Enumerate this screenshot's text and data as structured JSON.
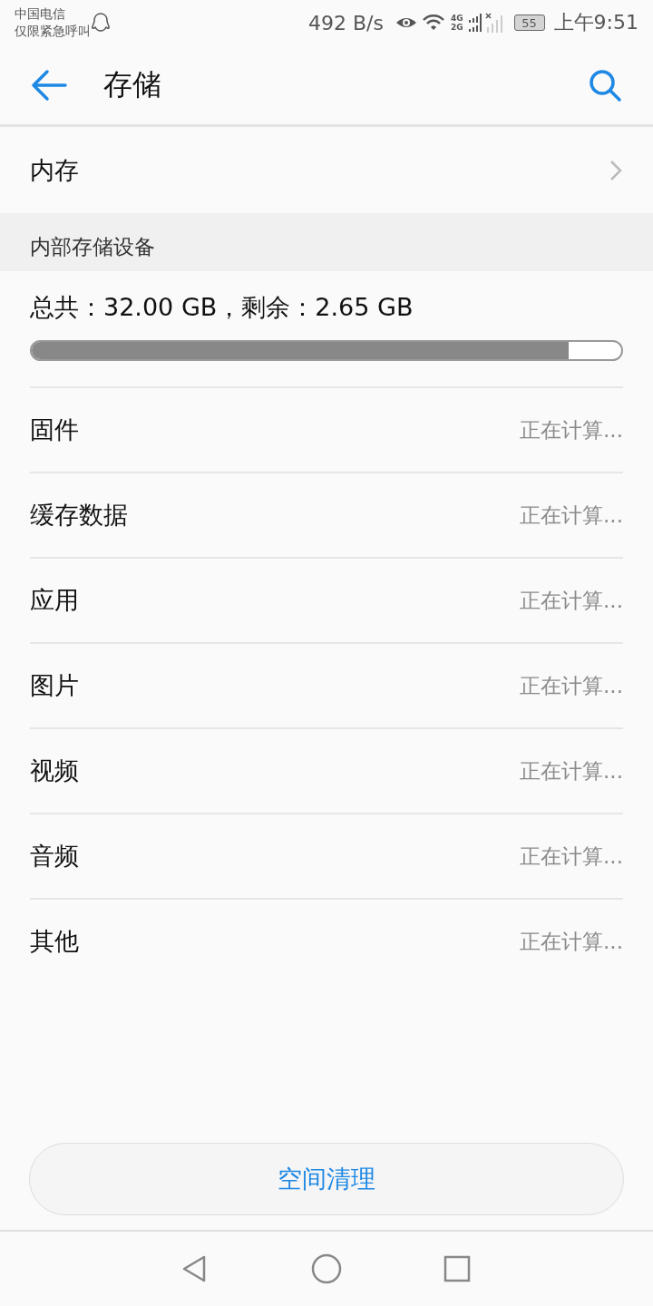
{
  "status_bar": {
    "carrier": "中国电信",
    "carrier_note": "仅限紧急呼叫",
    "speed": "492 B/s",
    "network_1": "4G",
    "network_2": "2G",
    "battery": "55",
    "time": "上午9:51"
  },
  "app_bar": {
    "title": "存储"
  },
  "memory_row": {
    "label": "内存"
  },
  "section": {
    "title": "内部存储设备"
  },
  "summary": {
    "text": "总共：32.00 GB，剩余：2.65 GB",
    "level": 0.91
  },
  "items": [
    {
      "label": "固件",
      "value": "正在计算..."
    },
    {
      "label": "缓存数据",
      "value": "正在计算..."
    },
    {
      "label": "应用",
      "value": "正在计算..."
    },
    {
      "label": "图片",
      "value": "正在计算..."
    },
    {
      "label": "视频",
      "value": "正在计算..."
    },
    {
      "label": "音频",
      "value": "正在计算..."
    },
    {
      "label": "其他",
      "value": "正在计算..."
    }
  ],
  "clean_button": {
    "label": "空间清理"
  }
}
